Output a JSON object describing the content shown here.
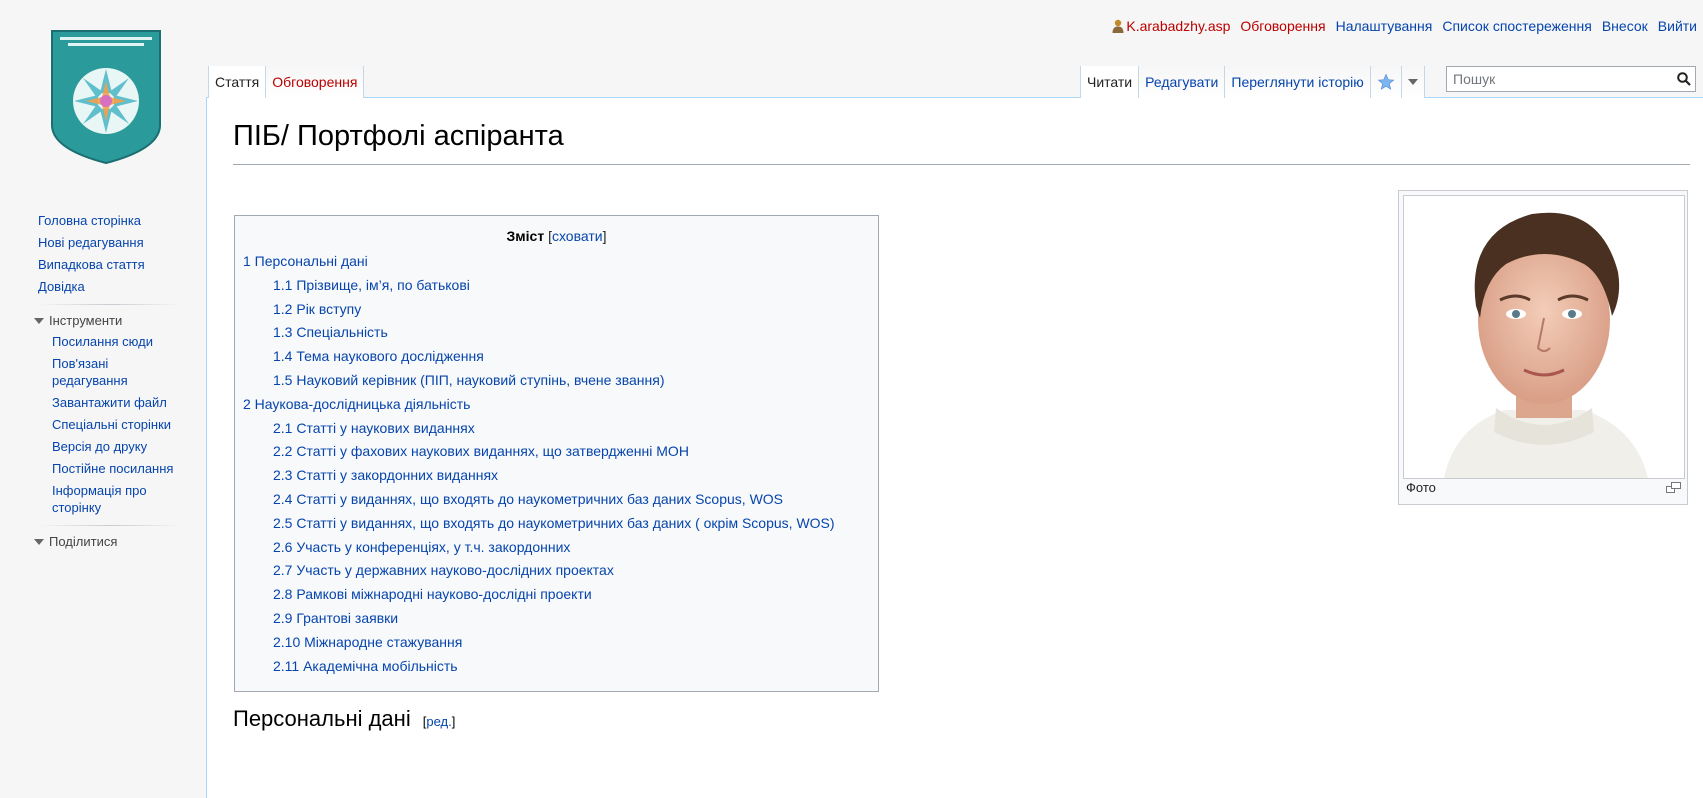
{
  "personal": {
    "username": "K.arabadzhy.asp",
    "links": [
      "Обговорення",
      "Налаштування",
      "Список спостереження",
      "Внесок",
      "Вийти"
    ]
  },
  "sidebar": {
    "nav": [
      "Головна сторінка",
      "Нові редагування",
      "Випадкова стаття",
      "Довідка"
    ],
    "tools_heading": "Інструменти",
    "tools": [
      "Посилання сюди",
      "Пов'язані редагування",
      "Завантажити файл",
      "Спеціальні сторінки",
      "Версія до друку",
      "Постійне посилання",
      "Інформація про сторінку"
    ],
    "share_heading": "Поділитися"
  },
  "tabs": {
    "left": [
      "Стаття",
      "Обговорення"
    ],
    "right": [
      "Читати",
      "Редагувати",
      "Переглянути історію"
    ]
  },
  "search": {
    "placeholder": "Пошук"
  },
  "page": {
    "title": "ПІБ/ Портфолі аспіранта",
    "section_heading": "Персональні дані",
    "section_edit": "ред."
  },
  "toc": {
    "title": "Зміст",
    "toggle": "сховати",
    "items": [
      {
        "level": 1,
        "text": "1 Персональні дані"
      },
      {
        "level": 2,
        "text": "1.1 Прізвище, ім’я, по батькові"
      },
      {
        "level": 2,
        "text": "1.2 Рік вступу"
      },
      {
        "level": 2,
        "text": "1.3 Спеціальність"
      },
      {
        "level": 2,
        "text": "1.4 Тема наукового дослідження"
      },
      {
        "level": 2,
        "text": "1.5 Науковий керівник (ПІП, науковий ступінь, вчене звання)"
      },
      {
        "level": 1,
        "text": "2 Наукова-дослідницька діяльність"
      },
      {
        "level": 2,
        "text": "2.1 Статті у наукових виданнях"
      },
      {
        "level": 2,
        "text": "2.2 Статті у фахових наукових виданнях, що затвердженні МОН"
      },
      {
        "level": 2,
        "text": "2.3 Статті у закордонних виданнях"
      },
      {
        "level": 2,
        "text": "2.4 Статті у виданнях, що входять до наукометричних баз даних Scopus, WOS"
      },
      {
        "level": 2,
        "text": "2.5 Статті у виданнях, що входять до наукометричних баз даних ( окрім Scopus, WOS)"
      },
      {
        "level": 2,
        "text": "2.6 Участь у конференціях, у т.ч. закордонних"
      },
      {
        "level": 2,
        "text": "2.7 Участь у державних науково-дослідних проектах"
      },
      {
        "level": 2,
        "text": "2.8 Рамкові міжнародні науково-дослідні проекти"
      },
      {
        "level": 2,
        "text": "2.9 Грантові заявки"
      },
      {
        "level": 2,
        "text": "2.10 Міжнародне стажування"
      },
      {
        "level": 2,
        "text": "2.11 Академічна мобільність"
      }
    ]
  },
  "thumb": {
    "caption": "Фото"
  },
  "colors": {
    "link": "#0645ad",
    "redlink": "#ba0000",
    "border": "#a7d7f9",
    "logo_teal": "#1f8f8f"
  }
}
